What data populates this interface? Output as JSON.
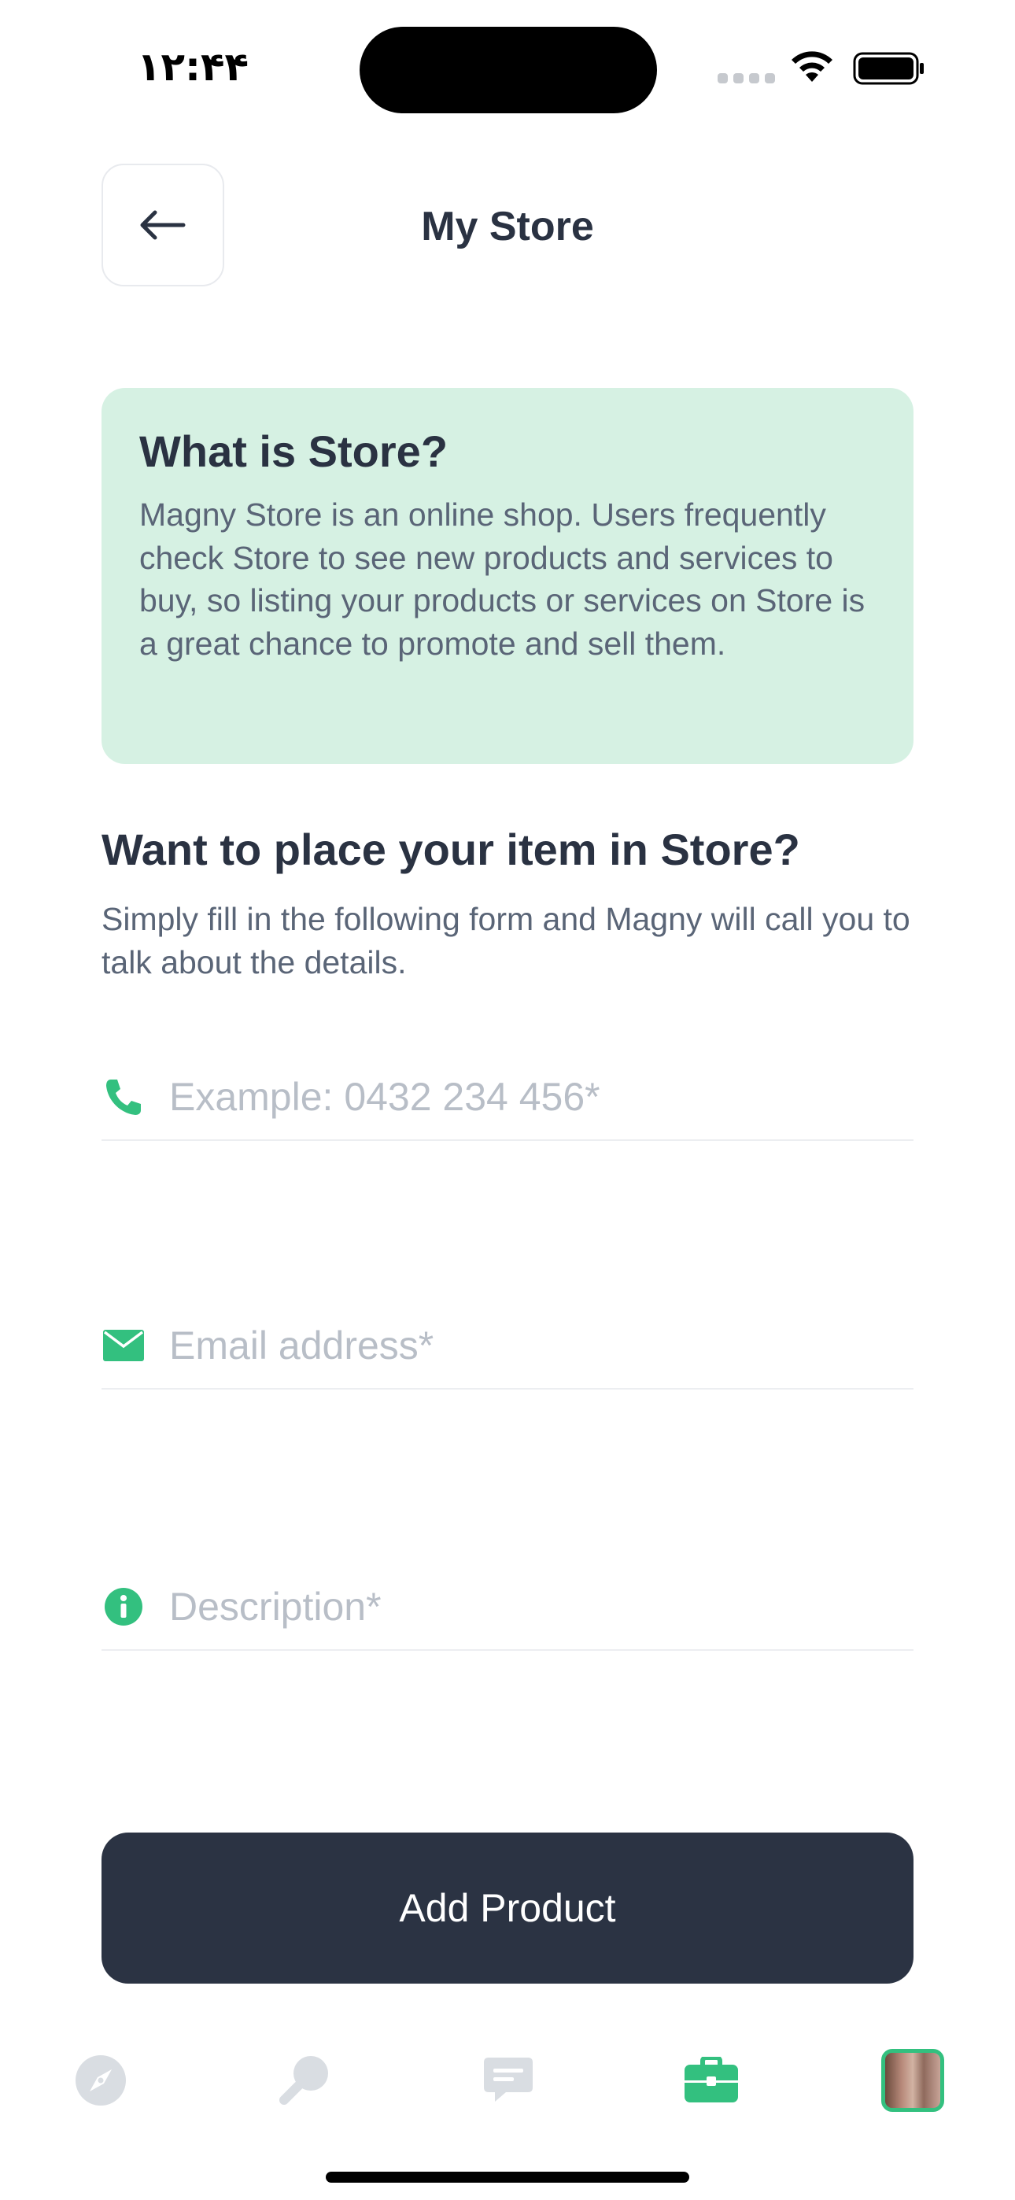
{
  "status_bar": {
    "time": "۱۲:۴۴",
    "icons": [
      "cellular-dots-icon",
      "wifi-icon",
      "battery-icon"
    ]
  },
  "header": {
    "back_icon": "arrow-left-icon",
    "title": "My Store"
  },
  "info_card": {
    "title": "What is Store?",
    "body": "Magny Store is an online shop. Users frequently check Store to see new products and services to buy, so listing your products or services on Store is a great chance to promote and sell them.",
    "background_color": "#d6f1e3"
  },
  "section": {
    "title": "Want to place your item in Store?",
    "body": "Simply fill in the following form and Magny will call you to talk about the details."
  },
  "form": {
    "phone": {
      "icon": "phone-icon",
      "placeholder": "Example: 0432 234 456*",
      "value": ""
    },
    "email": {
      "icon": "envelope-icon",
      "placeholder": "Email address*",
      "value": ""
    },
    "description": {
      "icon": "info-circle-icon",
      "placeholder": "Description*",
      "value": ""
    }
  },
  "primary_button": {
    "label": "Add Product",
    "background_color": "#2b3343"
  },
  "tab_bar": {
    "items": [
      {
        "icon": "compass-icon",
        "active": false
      },
      {
        "icon": "search-icon",
        "active": false
      },
      {
        "icon": "chat-icon",
        "active": false
      },
      {
        "icon": "briefcase-icon",
        "active": true
      },
      {
        "icon": "avatar",
        "active": false
      }
    ]
  },
  "colors": {
    "accent": "#33c07f",
    "text_dark": "#2a3242",
    "text_muted": "#5a6577",
    "placeholder": "#b8bec7",
    "inactive_icon": "#d9dde2"
  }
}
